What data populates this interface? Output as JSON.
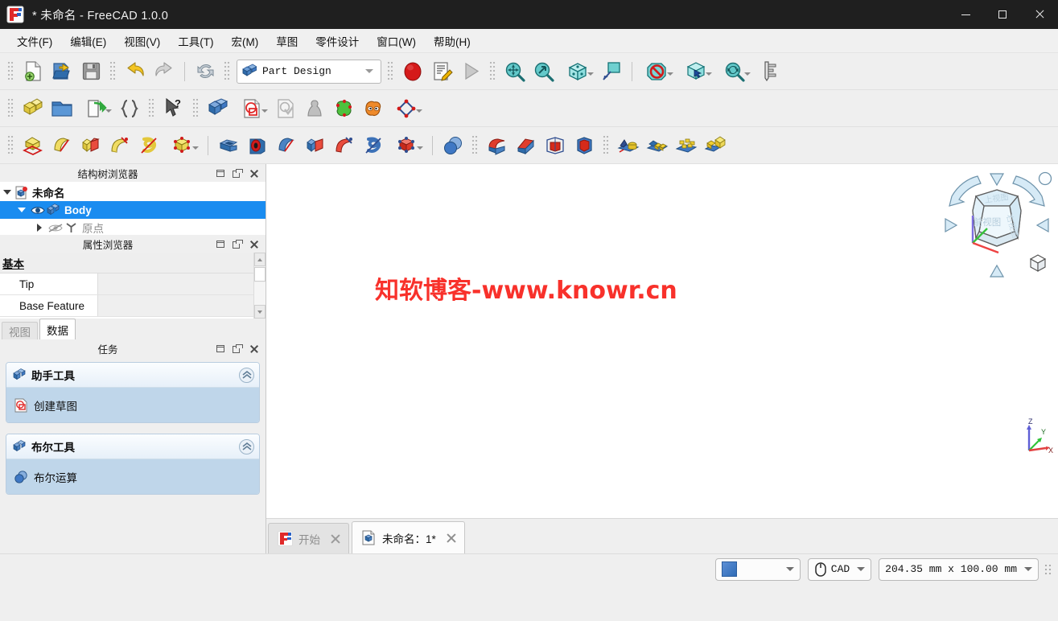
{
  "window": {
    "title": "* 未命名 - FreeCAD 1.0.0",
    "minimize_label": "最小化",
    "maximize_label": "最大化",
    "close_label": "关闭"
  },
  "menubar": {
    "items": [
      {
        "label": "文件(F)"
      },
      {
        "label": "编辑(E)"
      },
      {
        "label": "视图(V)"
      },
      {
        "label": "工具(T)"
      },
      {
        "label": "宏(M)"
      },
      {
        "label": "草图"
      },
      {
        "label": "零件设计"
      },
      {
        "label": "窗口(W)"
      },
      {
        "label": "帮助(H)"
      }
    ]
  },
  "toolbars": {
    "file": {
      "buttons": [
        {
          "name": "new-document-icon",
          "tip": "新建"
        },
        {
          "name": "open-document-icon",
          "tip": "打开"
        },
        {
          "name": "save-document-icon",
          "tip": "保存"
        },
        {
          "name": "undo-icon",
          "tip": "撤销"
        },
        {
          "name": "redo-icon",
          "tip": "重做"
        },
        {
          "name": "refresh-icon",
          "tip": "刷新"
        }
      ]
    },
    "workbench": {
      "selected": "Part Design",
      "icon": "part-design-workbench-icon"
    },
    "macro": {
      "buttons": [
        {
          "name": "macro-record-icon",
          "tip": "录制宏"
        },
        {
          "name": "macro-edit-icon",
          "tip": "宏编辑器"
        },
        {
          "name": "macro-execute-icon",
          "tip": "执行宏"
        }
      ]
    },
    "view": {
      "buttons": [
        {
          "name": "fit-all-icon",
          "tip": "适应全部"
        },
        {
          "name": "fit-selection-icon",
          "tip": "适应选择"
        },
        {
          "name": "axonometric-view-icon",
          "tip": "轴测视图"
        },
        {
          "name": "draw-style-icon",
          "tip": "绘制样式"
        },
        {
          "name": "clipping-off-icon",
          "tip": "无剖切"
        },
        {
          "name": "selection-view-icon",
          "tip": "选择视图"
        },
        {
          "name": "sync-view-icon",
          "tip": "缩放"
        },
        {
          "name": "measure-icon",
          "tip": "测量"
        }
      ]
    },
    "structure": {
      "buttons": [
        {
          "name": "create-part-icon",
          "tip": "创建零件"
        },
        {
          "name": "create-group-icon",
          "tip": "创建组"
        },
        {
          "name": "make-link-icon",
          "tip": "创建链接"
        },
        {
          "name": "variable-set-icon",
          "tip": "变量集"
        },
        {
          "name": "whats-this-icon",
          "tip": "这是什么？"
        },
        {
          "name": "create-body-icon",
          "tip": "创建实体"
        },
        {
          "name": "create-sketch-icon",
          "tip": "创建草图"
        },
        {
          "name": "validate-sketch-icon",
          "tip": "验证草图"
        },
        {
          "name": "attach-shape-icon",
          "tip": "附加形状"
        },
        {
          "name": "shape-binder-icon",
          "tip": "形状绑定器"
        },
        {
          "name": "clone-icon",
          "tip": "创建克隆"
        },
        {
          "name": "datum-icon",
          "tip": "基准几何"
        }
      ]
    },
    "features": {
      "additive": [
        {
          "name": "pad-icon",
          "tip": "凸台"
        },
        {
          "name": "revolution-icon",
          "tip": "旋转"
        },
        {
          "name": "additive-loft-icon",
          "tip": "增料放样"
        },
        {
          "name": "additive-pipe-icon",
          "tip": "增料管道"
        },
        {
          "name": "additive-helix-icon",
          "tip": "增料螺旋"
        },
        {
          "name": "additive-primitive-icon",
          "tip": "增料基本体"
        }
      ],
      "subtractive": [
        {
          "name": "pocket-icon",
          "tip": "凹坑"
        },
        {
          "name": "hole-icon",
          "tip": "孔"
        },
        {
          "name": "groove-icon",
          "tip": "开槽"
        },
        {
          "name": "subtractive-loft-icon",
          "tip": "减料放样"
        },
        {
          "name": "subtractive-pipe-icon",
          "tip": "减料管道"
        },
        {
          "name": "subtractive-helix-icon",
          "tip": "减料螺旋"
        },
        {
          "name": "subtractive-primitive-icon",
          "tip": "减料基本体"
        }
      ],
      "boolean": [
        {
          "name": "boolean-operation-icon",
          "tip": "布尔运算"
        }
      ],
      "dress_up": [
        {
          "name": "fillet-icon",
          "tip": "圆角"
        },
        {
          "name": "chamfer-icon",
          "tip": "倒角"
        },
        {
          "name": "draft-icon",
          "tip": "拔模"
        },
        {
          "name": "thickness-icon",
          "tip": "抽壳"
        }
      ],
      "transform": [
        {
          "name": "mirrored-icon",
          "tip": "镜像"
        },
        {
          "name": "linear-pattern-icon",
          "tip": "线性阵列"
        },
        {
          "name": "polar-pattern-icon",
          "tip": "极坐标阵列"
        },
        {
          "name": "multi-transform-icon",
          "tip": "多重变换"
        }
      ]
    }
  },
  "panels": {
    "tree": {
      "title": "结构树浏览器",
      "nodes": [
        {
          "label": "未命名",
          "icon": "document-icon",
          "expanded": true,
          "selected": false
        },
        {
          "label": "Body",
          "icon": "body-icon",
          "expanded": true,
          "selected": true
        },
        {
          "label": "原点",
          "icon": "origin-icon",
          "expanded": false,
          "selected": false
        }
      ]
    },
    "property": {
      "title": "属性浏览器",
      "group": "基本",
      "rows": [
        {
          "key": "Tip",
          "value": ""
        },
        {
          "key": "Base Feature",
          "value": ""
        }
      ],
      "tabs": [
        {
          "label": "视图",
          "active": false
        },
        {
          "label": "数据",
          "active": true
        }
      ]
    },
    "tasks": {
      "title": "任务",
      "groups": [
        {
          "label": "助手工具",
          "icon": "body-icon",
          "items": [
            {
              "label": "创建草图",
              "icon": "create-sketch-icon"
            }
          ]
        },
        {
          "label": "布尔工具",
          "icon": "body-icon",
          "items": [
            {
              "label": "布尔运算",
              "icon": "boolean-operation-icon"
            }
          ]
        }
      ]
    }
  },
  "view3d": {
    "watermark": "知软博客-www.knowr.cn",
    "watermark_color": "#f8312b",
    "background": "#ffffff",
    "navigation_cube": {
      "faces": [
        {
          "label": "上视图"
        },
        {
          "label": "前视图"
        },
        {
          "label": "右视图"
        }
      ],
      "buttons": [
        {
          "name": "nav-arrow-up-icon"
        },
        {
          "name": "nav-arrow-down-icon"
        },
        {
          "name": "nav-arrow-left-icon"
        },
        {
          "name": "nav-arrow-right-icon"
        },
        {
          "name": "nav-rotate-left-icon"
        },
        {
          "name": "nav-rotate-right-icon"
        },
        {
          "name": "nav-rotate-circle-icon"
        },
        {
          "name": "nav-isometric-cube-icon"
        }
      ]
    },
    "axis_indicator": {
      "x": "X",
      "y": "Y",
      "z": "Z"
    }
  },
  "doc_tabs": [
    {
      "label": "开始",
      "icon": "freecad-logo-icon",
      "active": false
    },
    {
      "label": "未命名：1*",
      "icon": "document-icon",
      "active": true
    }
  ],
  "statusbar": {
    "color_combo": {
      "value": "",
      "swatch": "#3f78c4"
    },
    "navigation_combo": {
      "value": "CAD",
      "icon": "mouse-icon"
    },
    "dimension": "204.35 mm x 100.00 mm"
  }
}
